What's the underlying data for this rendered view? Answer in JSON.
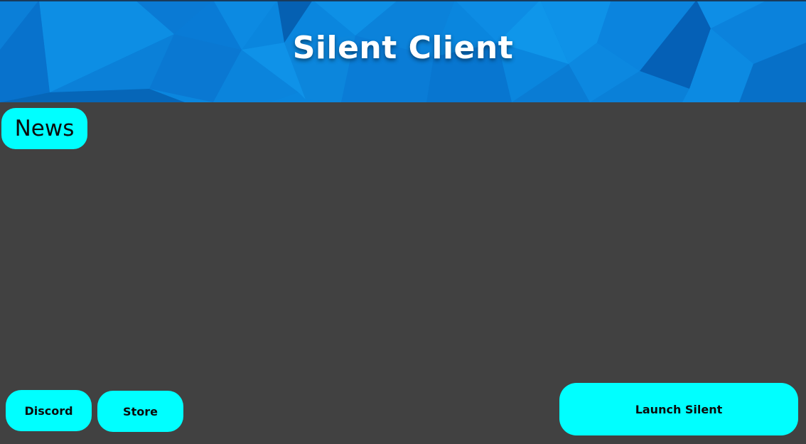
{
  "app": {
    "title": "Silent Client"
  },
  "tabs": {
    "news_label": "News"
  },
  "footer": {
    "discord_label": "Discord",
    "store_label": "Store",
    "launch_label": "Launch Silent"
  },
  "colors": {
    "background": "#414141",
    "accent": "#00ffff",
    "header_blue": "#0a84dc",
    "title_text": "#ffffff",
    "button_text": "#0b0b0b"
  }
}
